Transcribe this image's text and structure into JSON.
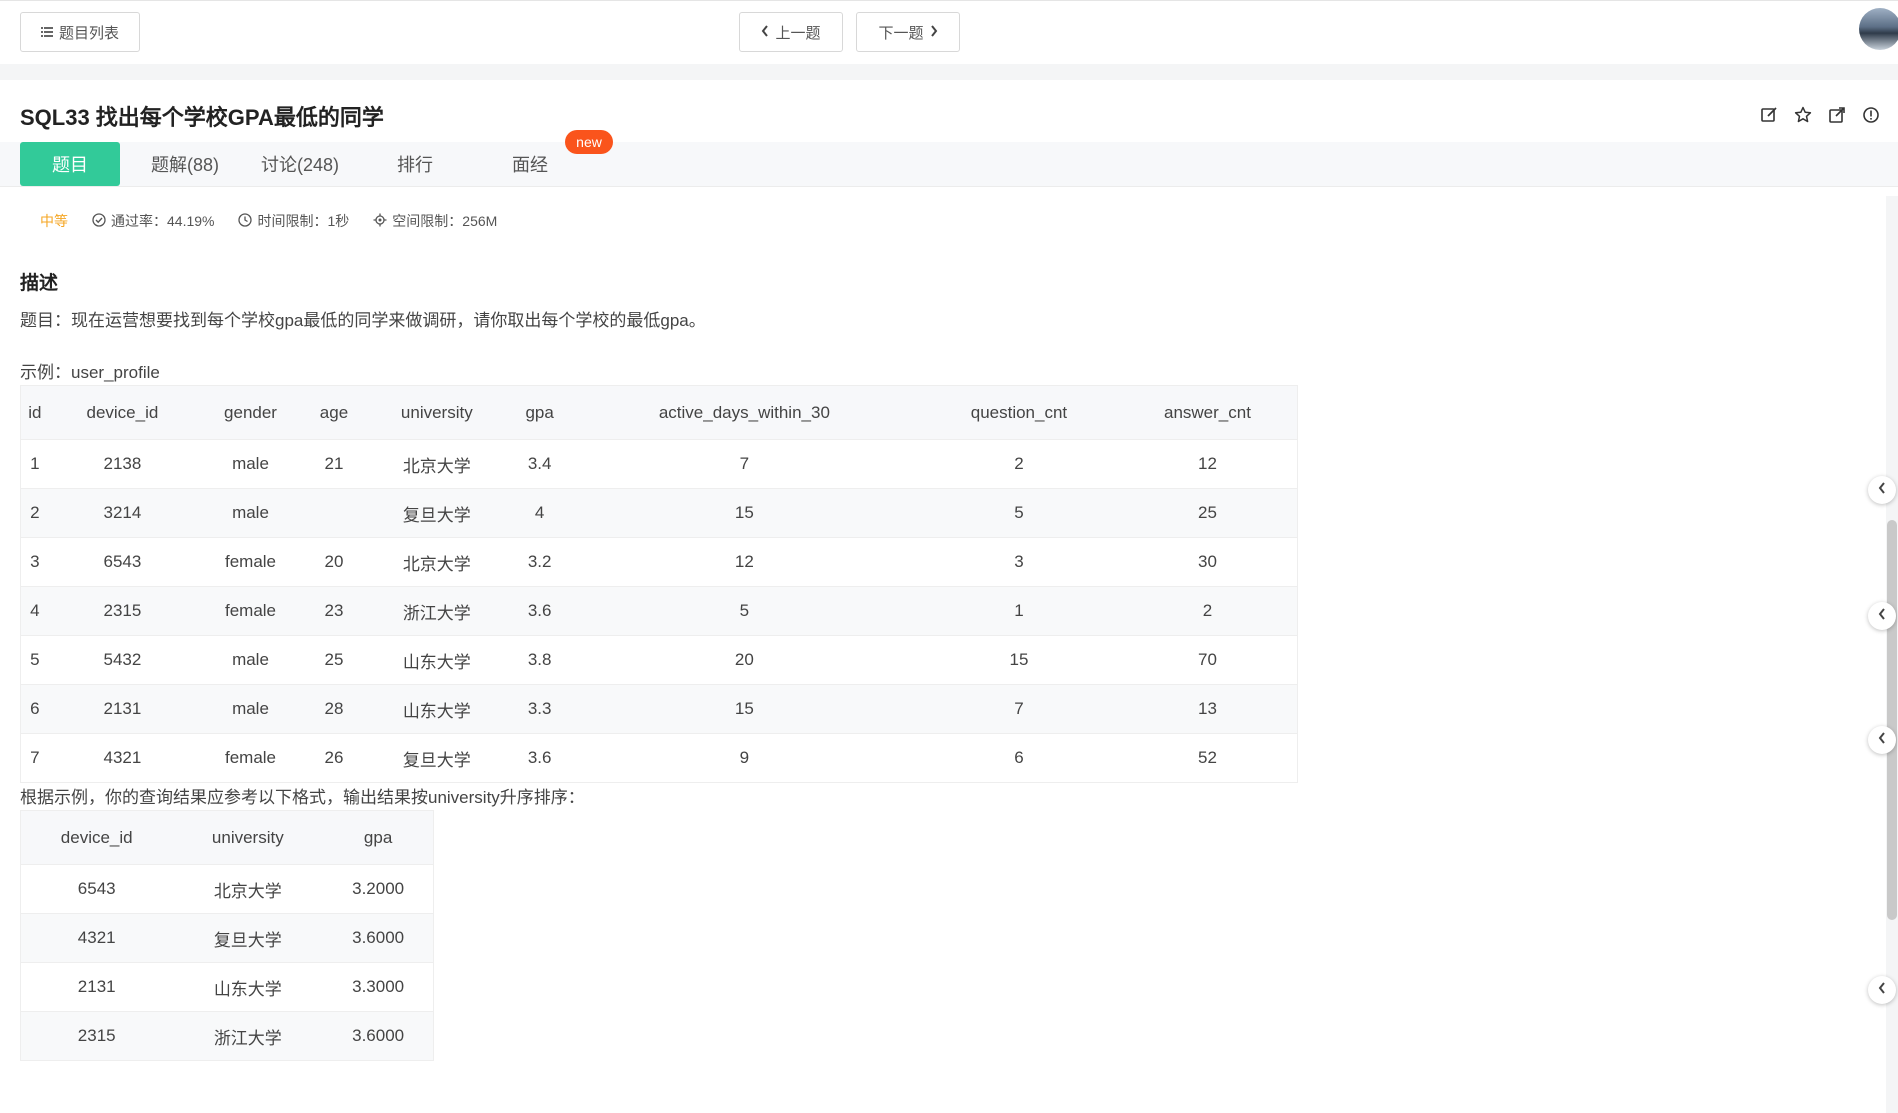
{
  "header": {
    "problem_list_label": "题目列表",
    "prev_label": "上一题",
    "next_label": "下一题"
  },
  "problem": {
    "title": "SQL33  找出每个学校GPA最低的同学"
  },
  "tabs": [
    {
      "label": "题目",
      "active": true
    },
    {
      "label": "题解(88)"
    },
    {
      "label": "讨论(248)"
    },
    {
      "label": "排行"
    },
    {
      "label": "面经"
    }
  ],
  "tab_badge": "new",
  "meta": {
    "difficulty": "中等",
    "pass_rate": "通过率：44.19%",
    "time_limit": "时间限制：1秒",
    "space_limit": "空间限制：256M"
  },
  "description": {
    "heading": "描述",
    "text": "题目：现在运营想要找到每个学校gpa最低的同学来做调研，请你取出每个学校的最低gpa。",
    "example_label": "示例：user_profile",
    "result_label": "根据示例，你的查询结果应参考以下格式，输出结果按university升序排序："
  },
  "example_table": {
    "columns": [
      "id",
      "device_id",
      "gender",
      "age",
      "university",
      "gpa",
      "active_days_within_30",
      "question_cnt",
      "answer_cnt"
    ],
    "rows": [
      [
        "1",
        "2138",
        "male",
        "21",
        "北京大学",
        "3.4",
        "7",
        "2",
        "12"
      ],
      [
        "2",
        "3214",
        "male",
        "",
        "复旦大学",
        "4",
        "15",
        "5",
        "25"
      ],
      [
        "3",
        "6543",
        "female",
        "20",
        "北京大学",
        "3.2",
        "12",
        "3",
        "30"
      ],
      [
        "4",
        "2315",
        "female",
        "23",
        "浙江大学",
        "3.6",
        "5",
        "1",
        "2"
      ],
      [
        "5",
        "5432",
        "male",
        "25",
        "山东大学",
        "3.8",
        "20",
        "15",
        "70"
      ],
      [
        "6",
        "2131",
        "male",
        "28",
        "山东大学",
        "3.3",
        "15",
        "7",
        "13"
      ],
      [
        "7",
        "4321",
        "female",
        "26",
        "复旦大学",
        "3.6",
        "9",
        "6",
        "52"
      ]
    ]
  },
  "result_table": {
    "columns": [
      "device_id",
      "university",
      "gpa"
    ],
    "rows": [
      [
        "6543",
        "北京大学",
        "3.2000"
      ],
      [
        "4321",
        "复旦大学",
        "3.6000"
      ],
      [
        "2131",
        "山东大学",
        "3.3000"
      ],
      [
        "2315",
        "浙江大学",
        "3.6000"
      ]
    ]
  },
  "colors": {
    "accent": "#32ca99",
    "difficulty": "#f5a623",
    "badge": "#fa541c"
  }
}
